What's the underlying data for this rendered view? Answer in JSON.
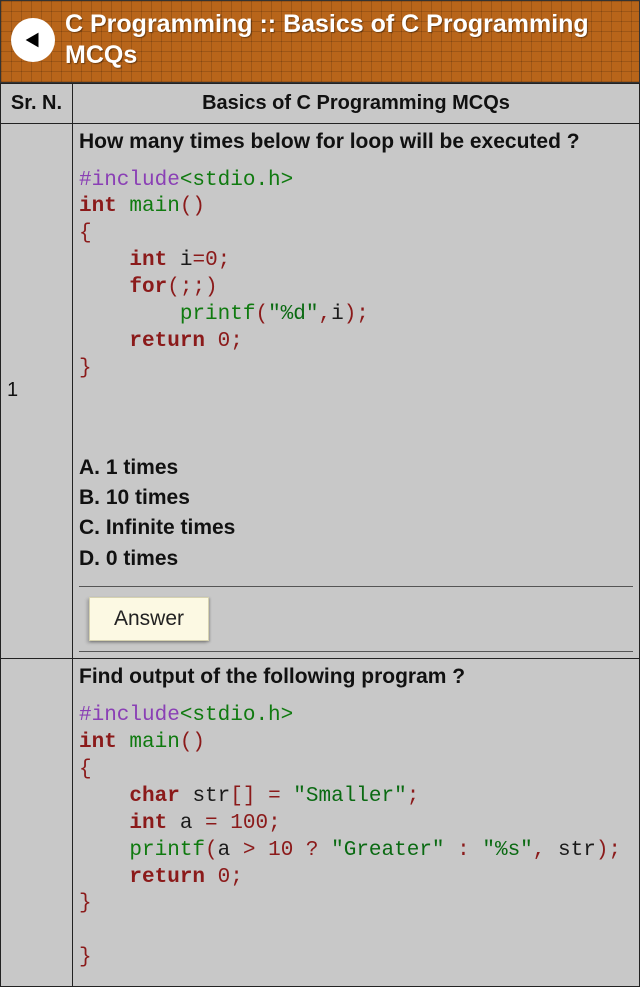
{
  "header": {
    "title": "C Programming :: Basics of C Programming MCQs"
  },
  "table": {
    "col1": "Sr. N.",
    "col2": "Basics of C Programming MCQs"
  },
  "q1": {
    "num": "1",
    "question": "How many times below for loop will be executed ?",
    "options": {
      "a": "A. 1 times",
      "b": "B. 10 times",
      "c": "C. Infinite times",
      "d": "D. 0 times"
    },
    "answer_label": "Answer",
    "code": {
      "l1a": "#include",
      "l1b": "<stdio.h>",
      "l2a": "int",
      "l2b": " main",
      "l2c": "()",
      "l3": "{",
      "l4a": "int",
      "l4b": " i",
      "l4c": "=",
      "l4d": "0",
      "l4e": ";",
      "l5a": "for",
      "l5b": "(;;)",
      "l6a": "printf",
      "l6b": "(",
      "l6c": "\"%d\"",
      "l6d": ",",
      "l6e": "i",
      "l6f": ");",
      "l7a": "return",
      "l7b": " 0",
      "l7c": ";",
      "l8": "}"
    }
  },
  "q2": {
    "question": "Find output of the following program ?",
    "code": {
      "l1a": "#include",
      "l1b": "<stdio.h>",
      "l2a": "int",
      "l2b": " main",
      "l2c": "()",
      "l3": "{",
      "l4a": "char",
      "l4b": " str",
      "l4c": "[]",
      "l4d": " = ",
      "l4e": "\"Smaller\"",
      "l4f": ";",
      "l5a": "int",
      "l5b": " a ",
      "l5c": "=",
      "l5d": " 100",
      "l5e": ";",
      "l6a": "printf",
      "l6b": "(",
      "l6c": "a ",
      "l6d": ">",
      "l6e": " 10 ",
      "l6f": "?",
      "l6g": " \"Greater\"",
      "l6h": " : ",
      "l6i": "\"%s\"",
      "l6j": ",",
      "l6k": " str",
      "l6l": ");",
      "l7a": "return",
      "l7b": " 0",
      "l7c": ";",
      "l8": "}",
      "l9": "}"
    }
  }
}
